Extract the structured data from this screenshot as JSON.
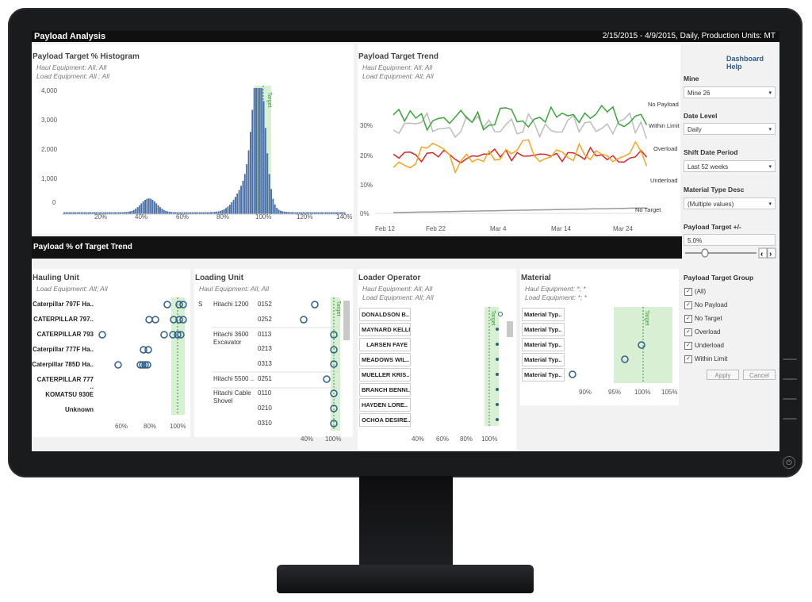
{
  "titlebar": {
    "title": "Payload Analysis",
    "range": "2/15/2015 - 4/9/2015, Daily, Production Units: MT"
  },
  "histogram": {
    "title": "Payload Target % Histogram",
    "sub1": "Haul Equipment: All; All",
    "sub2": "Load Equipment: All ; All",
    "yticks": [
      "4,000",
      "3,000",
      "2,000",
      "1,000",
      "0"
    ],
    "xticks": [
      "20%",
      "40%",
      "60%",
      "80%",
      "100%",
      "120%",
      "140%"
    ],
    "target_label": "Target",
    "target_value": 100
  },
  "trend": {
    "title": "Payload Target Trend",
    "sub1": "Haul Equipment: All; All",
    "sub2": "Load Equipment: All; All",
    "yticks": [
      "30%",
      "20%",
      "10%",
      "0%"
    ],
    "xticks": [
      "Feb 12",
      "Feb 22",
      "Mar 4",
      "Mar 14",
      "Mar 24"
    ],
    "series_labels": [
      "No Payload",
      "Within Limit",
      "Overload",
      "Underload",
      "No Target"
    ],
    "colors": {
      "within": "#3aa63a",
      "nopayload": "#bdbdbd",
      "overload": "#d62728",
      "underload": "#f5a623",
      "notarget": "#9a9a9a"
    }
  },
  "dashboard_help": "Dashboard Help",
  "controls": {
    "mine_label": "Mine",
    "mine_value": "Mine 26",
    "date_level_label": "Date Level",
    "date_level_value": "Daily",
    "shift_label": "Shift Date Period",
    "shift_value": "Last 52 weeks",
    "material_label": "Material Type Desc",
    "material_value": "(Multiple values)",
    "target_pm_label": "Payload Target +/-",
    "target_pm_value": "5.0%",
    "group_label": "Payload Target Group",
    "group_items": [
      "(All)",
      "No Payload",
      "No Target",
      "Overload",
      "Underload",
      "Within Limit"
    ],
    "apply": "Apply",
    "cancel": "Cancel",
    "arrow": "▾"
  },
  "section_title": "Payload % of Target Trend",
  "hauling": {
    "title": "Hauling Unit",
    "sub": "Load Equipment: All; All",
    "rows": [
      "Caterpillar 797F Ha..",
      "CATERPILLAR 797..",
      "CATERPILLAR 793",
      "Caterpillar 777F Ha..",
      "Caterpillar 785D Ha..",
      "CATERPILLAR 777 ..",
      "KOMATSU 930E",
      "Unknown"
    ],
    "xticks": [
      "60%",
      "80%",
      "100%"
    ]
  },
  "loading": {
    "title": "Loading Unit",
    "sub": "Haul Equipment: All; All",
    "s_label": "S",
    "models": [
      "Hitachi 1200",
      "Hitachi 3600 Excavator",
      "Hitachi 5500 ..",
      "Hitachi Cable Shovel"
    ],
    "units": [
      "0152",
      "0252",
      "0113",
      "0213",
      "0313",
      "0251",
      "0110",
      "0210",
      "0310"
    ],
    "xticks": [
      "40%",
      "100%"
    ],
    "target_label": "Target"
  },
  "operator": {
    "title": "Loader Operator",
    "sub1": "Haul Equipment: All; All",
    "sub2": "Load Equipment: All; All",
    "rows": [
      "DONALDSON B..",
      "MAYNARD KELLI",
      "LARSEN FAYE",
      "MEADOWS WIL..",
      "MUELLER KRIS..",
      "BRANCH BENNI..",
      "HAYDEN LORE..",
      "OCHOA DESIRE.."
    ],
    "xticks": [
      "40%",
      "60%",
      "80%",
      "100%"
    ],
    "target_label": "Target"
  },
  "material": {
    "title": "Material",
    "sub1": "Haul Equipment: *; *",
    "sub2": "Load Equipment: *; *",
    "rows": [
      "Material Typ..",
      "Material Typ..",
      "Material Typ..",
      "Material Typ..",
      "Material Typ.."
    ],
    "xticks": [
      "90%",
      "95%",
      "100%",
      "105%"
    ],
    "target_label": "Target"
  }
}
